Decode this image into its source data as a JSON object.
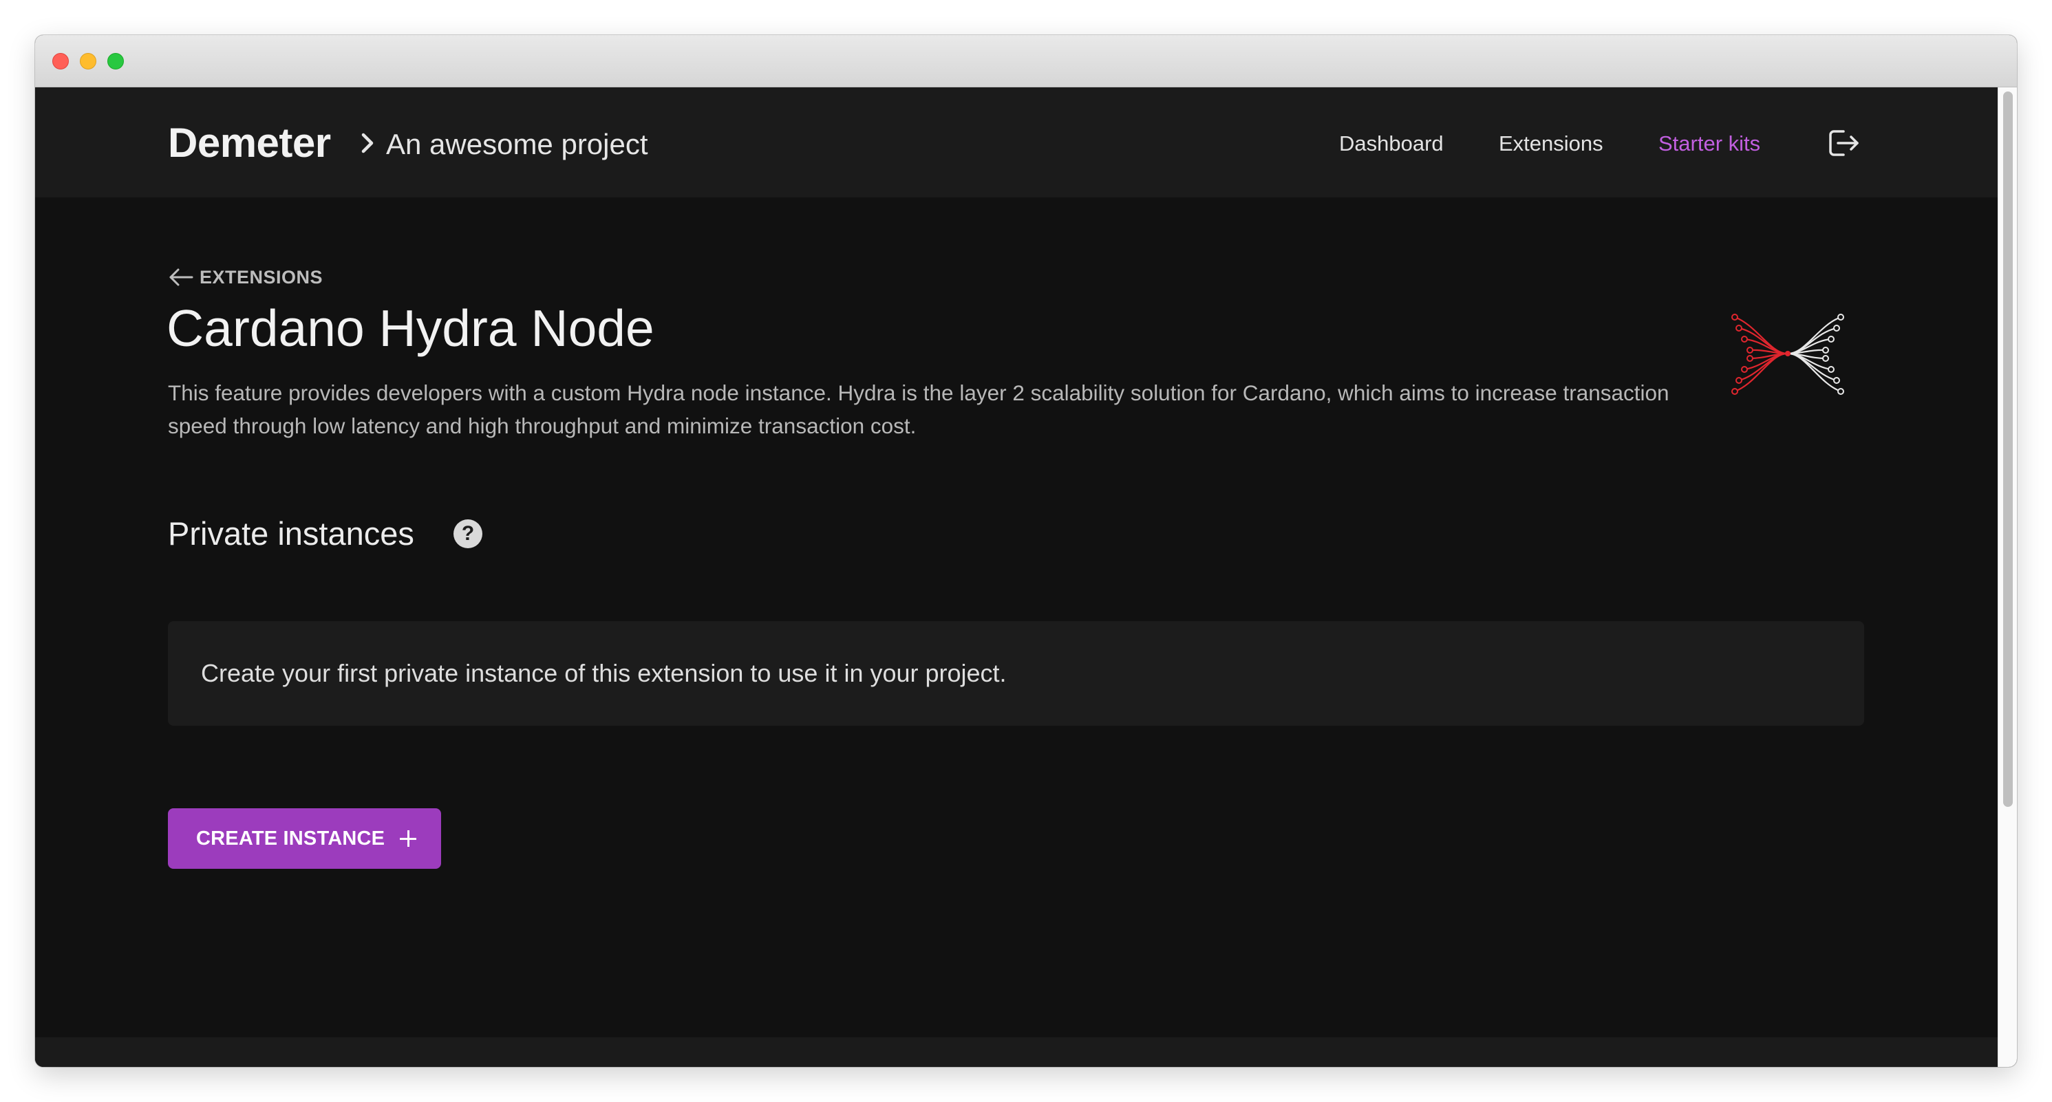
{
  "header": {
    "brand": "Demeter",
    "project_name": "An awesome project",
    "nav": [
      {
        "label": "Dashboard"
      },
      {
        "label": "Extensions"
      },
      {
        "label": "Starter kits"
      }
    ],
    "active_nav_color": "#c25fe0"
  },
  "page": {
    "back_label": "EXTENSIONS",
    "title": "Cardano Hydra Node",
    "description": "This feature provides developers with a custom Hydra node instance. Hydra is the layer 2 scalability solution for Cardano, which aims to increase transaction speed through low latency and high throughput and minimize transaction cost.",
    "logo_icon": "hydra-logo"
  },
  "instances": {
    "section_title": "Private instances",
    "help_glyph": "?",
    "empty_message": "Create your first private instance of this extension to use it in your project.",
    "create_label": "CREATE INSTANCE"
  },
  "colors": {
    "background": "#111111",
    "header": "#1b1b1b",
    "accent": "#9c3cbd",
    "logo_red": "#e0262e"
  }
}
